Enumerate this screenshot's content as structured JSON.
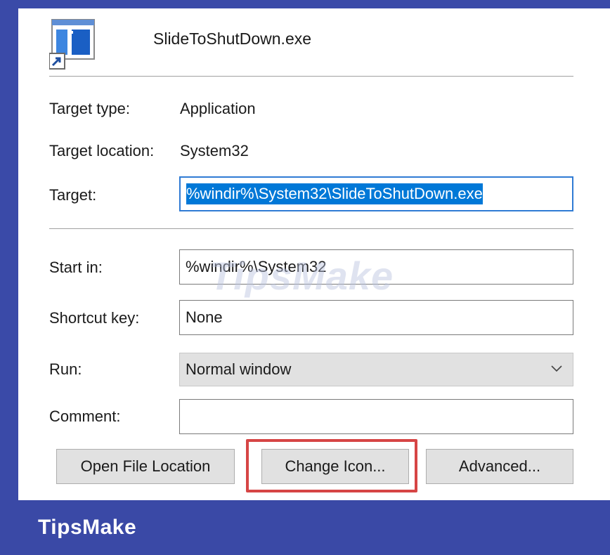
{
  "header": {
    "file_name": "SlideToShutDown.exe",
    "icon": "shortcut-app-icon"
  },
  "target_type": {
    "label": "Target type:",
    "value": "Application"
  },
  "target_location": {
    "label": "Target location:",
    "value": "System32"
  },
  "target": {
    "label": "Target:",
    "value": "%windir%\\System32\\SlideToShutDown.exe"
  },
  "start_in": {
    "label": "Start in:",
    "value": "%windir%\\System32"
  },
  "shortcut_key": {
    "label": "Shortcut key:",
    "value": "None"
  },
  "run": {
    "label": "Run:",
    "value": "Normal window",
    "icon": "chevron-down-icon"
  },
  "comment": {
    "label": "Comment:",
    "value": ""
  },
  "buttons": {
    "open_file_location": "Open File Location",
    "change_icon": "Change Icon...",
    "advanced": "Advanced..."
  },
  "watermark": "TipsMake",
  "footer": {
    "brand": "TipsMake"
  },
  "colors": {
    "frame": "#3a4aa8",
    "selection": "#0078d7",
    "highlight": "#d64545",
    "button": "#e1e1e1"
  }
}
